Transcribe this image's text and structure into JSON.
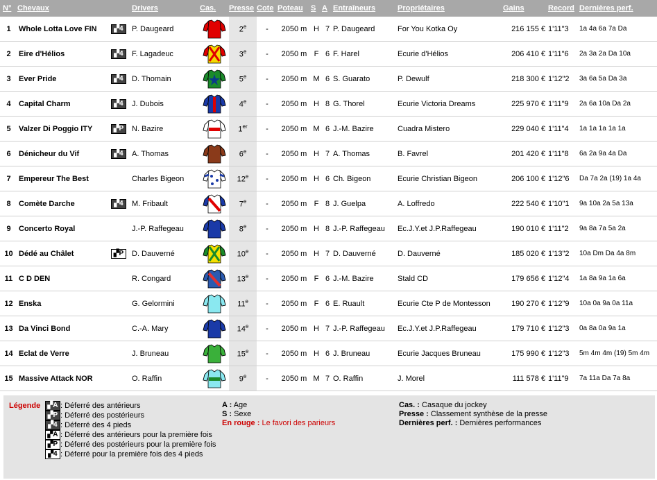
{
  "headers": {
    "num": "N°",
    "horses": "Chevaux",
    "drivers": "Drivers",
    "cas": "Cas.",
    "presse": "Presse",
    "cote": "Cote",
    "poteau": "Poteau",
    "sexe": "S",
    "age": "A",
    "trainers": "Entraîneurs",
    "owners": "Propriétaires",
    "gains": "Gains",
    "record": "Record",
    "perf": "Dernières perf."
  },
  "rows": [
    {
      "num": "1",
      "name": "Whole Lotta Love FIN",
      "badge": "4",
      "badge_style": "dark",
      "driver": "P. Daugeard",
      "jacket": {
        "body": "#e00000",
        "sleeve": "#e00000",
        "accent": "#111111",
        "pattern": "plain"
      },
      "presse": "2e",
      "cote": "-",
      "poteau": "2050 m",
      "sexe": "H",
      "age": "7",
      "trainer": "P. Daugeard",
      "owner": "For You Kotka Oy",
      "gains": "216 155 €",
      "record": "1'11\"3",
      "perf": "1a 4a 6a 7a Da"
    },
    {
      "num": "2",
      "name": "Eire d'Hélios",
      "badge": "4",
      "badge_style": "dark",
      "driver": "F. Lagadeuc",
      "jacket": {
        "body": "#f5d800",
        "sleeve": "#e00000",
        "accent": "#e00000",
        "pattern": "cross"
      },
      "presse": "3e",
      "cote": "-",
      "poteau": "2050 m",
      "sexe": "F",
      "age": "6",
      "trainer": "F. Harel",
      "owner": "Ecurie d'Hélios",
      "gains": "206 410 €",
      "record": "1'11\"6",
      "perf": "2a 3a 2a Da 10a"
    },
    {
      "num": "3",
      "name": "Ever Pride",
      "badge": "4",
      "badge_style": "dark",
      "driver": "D. Thomain",
      "jacket": {
        "body": "#1a8a2a",
        "sleeve": "#1a8a2a",
        "accent": "#0a3a8a",
        "pattern": "star"
      },
      "presse": "5e",
      "cote": "-",
      "poteau": "2050 m",
      "sexe": "M",
      "age": "6",
      "trainer": "S. Guarato",
      "owner": "P. Dewulf",
      "gains": "218 300 €",
      "record": "1'12\"2",
      "perf": "3a 6a 5a Da 3a"
    },
    {
      "num": "4",
      "name": "Capital Charm",
      "badge": "4",
      "badge_style": "dark",
      "driver": "J. Dubois",
      "jacket": {
        "body": "#1a3aa8",
        "sleeve": "#1a3aa8",
        "accent": "#e00000",
        "pattern": "stripe"
      },
      "presse": "4e",
      "cote": "-",
      "poteau": "2050 m",
      "sexe": "H",
      "age": "8",
      "trainer": "G. Thorel",
      "owner": "Ecurie Victoria Dreams",
      "gains": "225 970 €",
      "record": "1'11\"9",
      "perf": "2a 6a 10a Da 2a"
    },
    {
      "num": "5",
      "name": "Valzer Di Poggio ITY",
      "badge": "P",
      "badge_style": "dark",
      "driver": "N. Bazire",
      "jacket": {
        "body": "#ffffff",
        "sleeve": "#ffffff",
        "accent": "#e00000",
        "pattern": "band"
      },
      "presse": "1er",
      "cote": "-",
      "poteau": "2050 m",
      "sexe": "M",
      "age": "6",
      "trainer": "J.-M. Bazire",
      "owner": "Cuadra Mistero",
      "gains": "229 040 €",
      "record": "1'11\"4",
      "perf": "1a 1a 1a 1a 1a"
    },
    {
      "num": "6",
      "name": "Dénicheur du Vif",
      "badge": "4",
      "badge_style": "dark",
      "driver": "A. Thomas",
      "jacket": {
        "body": "#8a3a1a",
        "sleeve": "#8a3a1a",
        "accent": "#8a3a1a",
        "pattern": "plain"
      },
      "presse": "6e",
      "cote": "-",
      "poteau": "2050 m",
      "sexe": "H",
      "age": "7",
      "trainer": "A. Thomas",
      "owner": "B. Favrel",
      "gains": "201 420 €",
      "record": "1'11\"8",
      "perf": "6a 2a 9a 4a Da"
    },
    {
      "num": "7",
      "name": "Empereur The Best",
      "badge": "",
      "badge_style": "none",
      "driver": "Charles Bigeon",
      "jacket": {
        "body": "#ffffff",
        "sleeve": "#ffffff",
        "accent": "#1a3aa8",
        "pattern": "diamonds"
      },
      "presse": "12e",
      "cote": "-",
      "poteau": "2050 m",
      "sexe": "H",
      "age": "6",
      "trainer": "Ch. Bigeon",
      "owner": "Ecurie Christian Bigeon",
      "gains": "206 100 €",
      "record": "1'12\"6",
      "perf": "Da 7a 2a (19) 1a 4a"
    },
    {
      "num": "8",
      "name": "Comète Darche",
      "badge": "4",
      "badge_style": "dark",
      "driver": "M. Fribault",
      "jacket": {
        "body": "#ffffff",
        "sleeve": "#1a3aa8",
        "accent": "#e00000",
        "pattern": "sash"
      },
      "presse": "7e",
      "cote": "-",
      "poteau": "2050 m",
      "sexe": "F",
      "age": "8",
      "trainer": "J. Guelpa",
      "owner": "A. Loffredo",
      "gains": "222 540 €",
      "record": "1'10\"1",
      "perf": "9a 10a 2a 5a 13a"
    },
    {
      "num": "9",
      "name": "Concerto Royal",
      "badge": "",
      "badge_style": "none",
      "driver": "J.-P. Raffegeau",
      "jacket": {
        "body": "#1a3aa8",
        "sleeve": "#1a3aa8",
        "accent": "#1a3aa8",
        "pattern": "plain"
      },
      "presse": "8e",
      "cote": "-",
      "poteau": "2050 m",
      "sexe": "H",
      "age": "8",
      "trainer": "J.-P. Raffegeau",
      "owner": "Ec.J.Y.et J.P.Raffegeau",
      "gains": "190 010 €",
      "record": "1'11\"2",
      "perf": "9a 8a 7a 5a 2a"
    },
    {
      "num": "10",
      "name": "Dédé au Châlet",
      "badge": "P",
      "badge_style": "light",
      "driver": "D. Dauverné",
      "jacket": {
        "body": "#f5e000",
        "sleeve": "#1a8a2a",
        "accent": "#1a8a2a",
        "pattern": "cross"
      },
      "presse": "10e",
      "cote": "-",
      "poteau": "2050 m",
      "sexe": "H",
      "age": "7",
      "trainer": "D. Dauverné",
      "owner": "D. Dauverné",
      "gains": "185 020 €",
      "record": "1'13\"2",
      "perf": "10a Dm Da 4a 8m"
    },
    {
      "num": "11",
      "name": "C D DEN",
      "badge": "",
      "badge_style": "none",
      "driver": "R. Congard",
      "jacket": {
        "body": "#2a5ab0",
        "sleeve": "#2a5ab0",
        "accent": "#e03030",
        "pattern": "sash"
      },
      "presse": "13e",
      "cote": "-",
      "poteau": "2050 m",
      "sexe": "F",
      "age": "6",
      "trainer": "J.-M. Bazire",
      "owner": "Stald CD",
      "gains": "179 656 €",
      "record": "1'12\"4",
      "perf": "1a 8a 9a 1a 6a"
    },
    {
      "num": "12",
      "name": "Enska",
      "badge": "",
      "badge_style": "none",
      "driver": "G. Gelormini",
      "jacket": {
        "body": "#8ae8f0",
        "sleeve": "#8ae8f0",
        "accent": "#8ae8f0",
        "pattern": "plain"
      },
      "presse": "11e",
      "cote": "-",
      "poteau": "2050 m",
      "sexe": "F",
      "age": "6",
      "trainer": "E. Ruault",
      "owner": "Ecurie Cte P de Montesson",
      "gains": "190 270 €",
      "record": "1'12\"9",
      "perf": "10a 0a 9a 0a 11a"
    },
    {
      "num": "13",
      "name": "Da Vinci Bond",
      "badge": "",
      "badge_style": "none",
      "driver": "C.-A. Mary",
      "jacket": {
        "body": "#1a3aa8",
        "sleeve": "#1a3aa8",
        "accent": "#1a3aa8",
        "pattern": "plain"
      },
      "presse": "14e",
      "cote": "-",
      "poteau": "2050 m",
      "sexe": "H",
      "age": "7",
      "trainer": "J.-P. Raffegeau",
      "owner": "Ec.J.Y.et J.P.Raffegeau",
      "gains": "179 710 €",
      "record": "1'12\"3",
      "perf": "0a 8a 0a 9a 1a"
    },
    {
      "num": "14",
      "name": "Eclat de Verre",
      "badge": "",
      "badge_style": "none",
      "driver": "J. Bruneau",
      "jacket": {
        "body": "#3ab03a",
        "sleeve": "#3ab03a",
        "accent": "#3ab03a",
        "pattern": "plain"
      },
      "presse": "15e",
      "cote": "-",
      "poteau": "2050 m",
      "sexe": "H",
      "age": "6",
      "trainer": "J. Bruneau",
      "owner": "Ecurie Jacques Bruneau",
      "gains": "175 990 €",
      "record": "1'12\"3",
      "perf": "5m 4m 4m (19) 5m 4m"
    },
    {
      "num": "15",
      "name": "Massive Attack NOR",
      "badge": "",
      "badge_style": "none",
      "driver": "O. Raffin",
      "jacket": {
        "body": "#8ae8f0",
        "sleeve": "#8ae8f0",
        "accent": "#1a8a2a",
        "pattern": "band"
      },
      "presse": "9e",
      "cote": "-",
      "poteau": "2050 m",
      "sexe": "M",
      "age": "7",
      "trainer": "O. Raffin",
      "owner": "J. Morel",
      "gains": "111 578 €",
      "record": "1'11\"9",
      "perf": "7a 11a Da 7a 8a"
    }
  ],
  "legend": {
    "title": "Légende",
    "badges": [
      {
        "glyph": "A",
        "style": "dark",
        "text": ": Déferré des antérieurs"
      },
      {
        "glyph": "P",
        "style": "dark",
        "text": ": Déferré des postérieurs"
      },
      {
        "glyph": "4",
        "style": "dark",
        "text": ": Déferré des 4 pieds"
      },
      {
        "glyph": "A",
        "style": "light",
        "text": ": Déferré des antérieurs pour la première fois"
      },
      {
        "glyph": "P",
        "style": "light",
        "text": ": Déferré des postérieurs pour la première fois"
      },
      {
        "glyph": "4",
        "style": "light",
        "text": ": Déferré pour la première fois des 4 pieds"
      }
    ],
    "col2": [
      {
        "key": "A :",
        "text": " Age"
      },
      {
        "key": "S :",
        "text": " Sexe"
      },
      {
        "key": "En rouge :",
        "text": " Le favori des parieurs",
        "red": true
      }
    ],
    "col3": [
      {
        "key": "Cas. :",
        "text": " Casaque du jockey"
      },
      {
        "key": "Presse :",
        "text": " Classement synthèse de la presse"
      },
      {
        "key": "Dernières perf. :",
        "text": " Dernières performances"
      }
    ]
  }
}
